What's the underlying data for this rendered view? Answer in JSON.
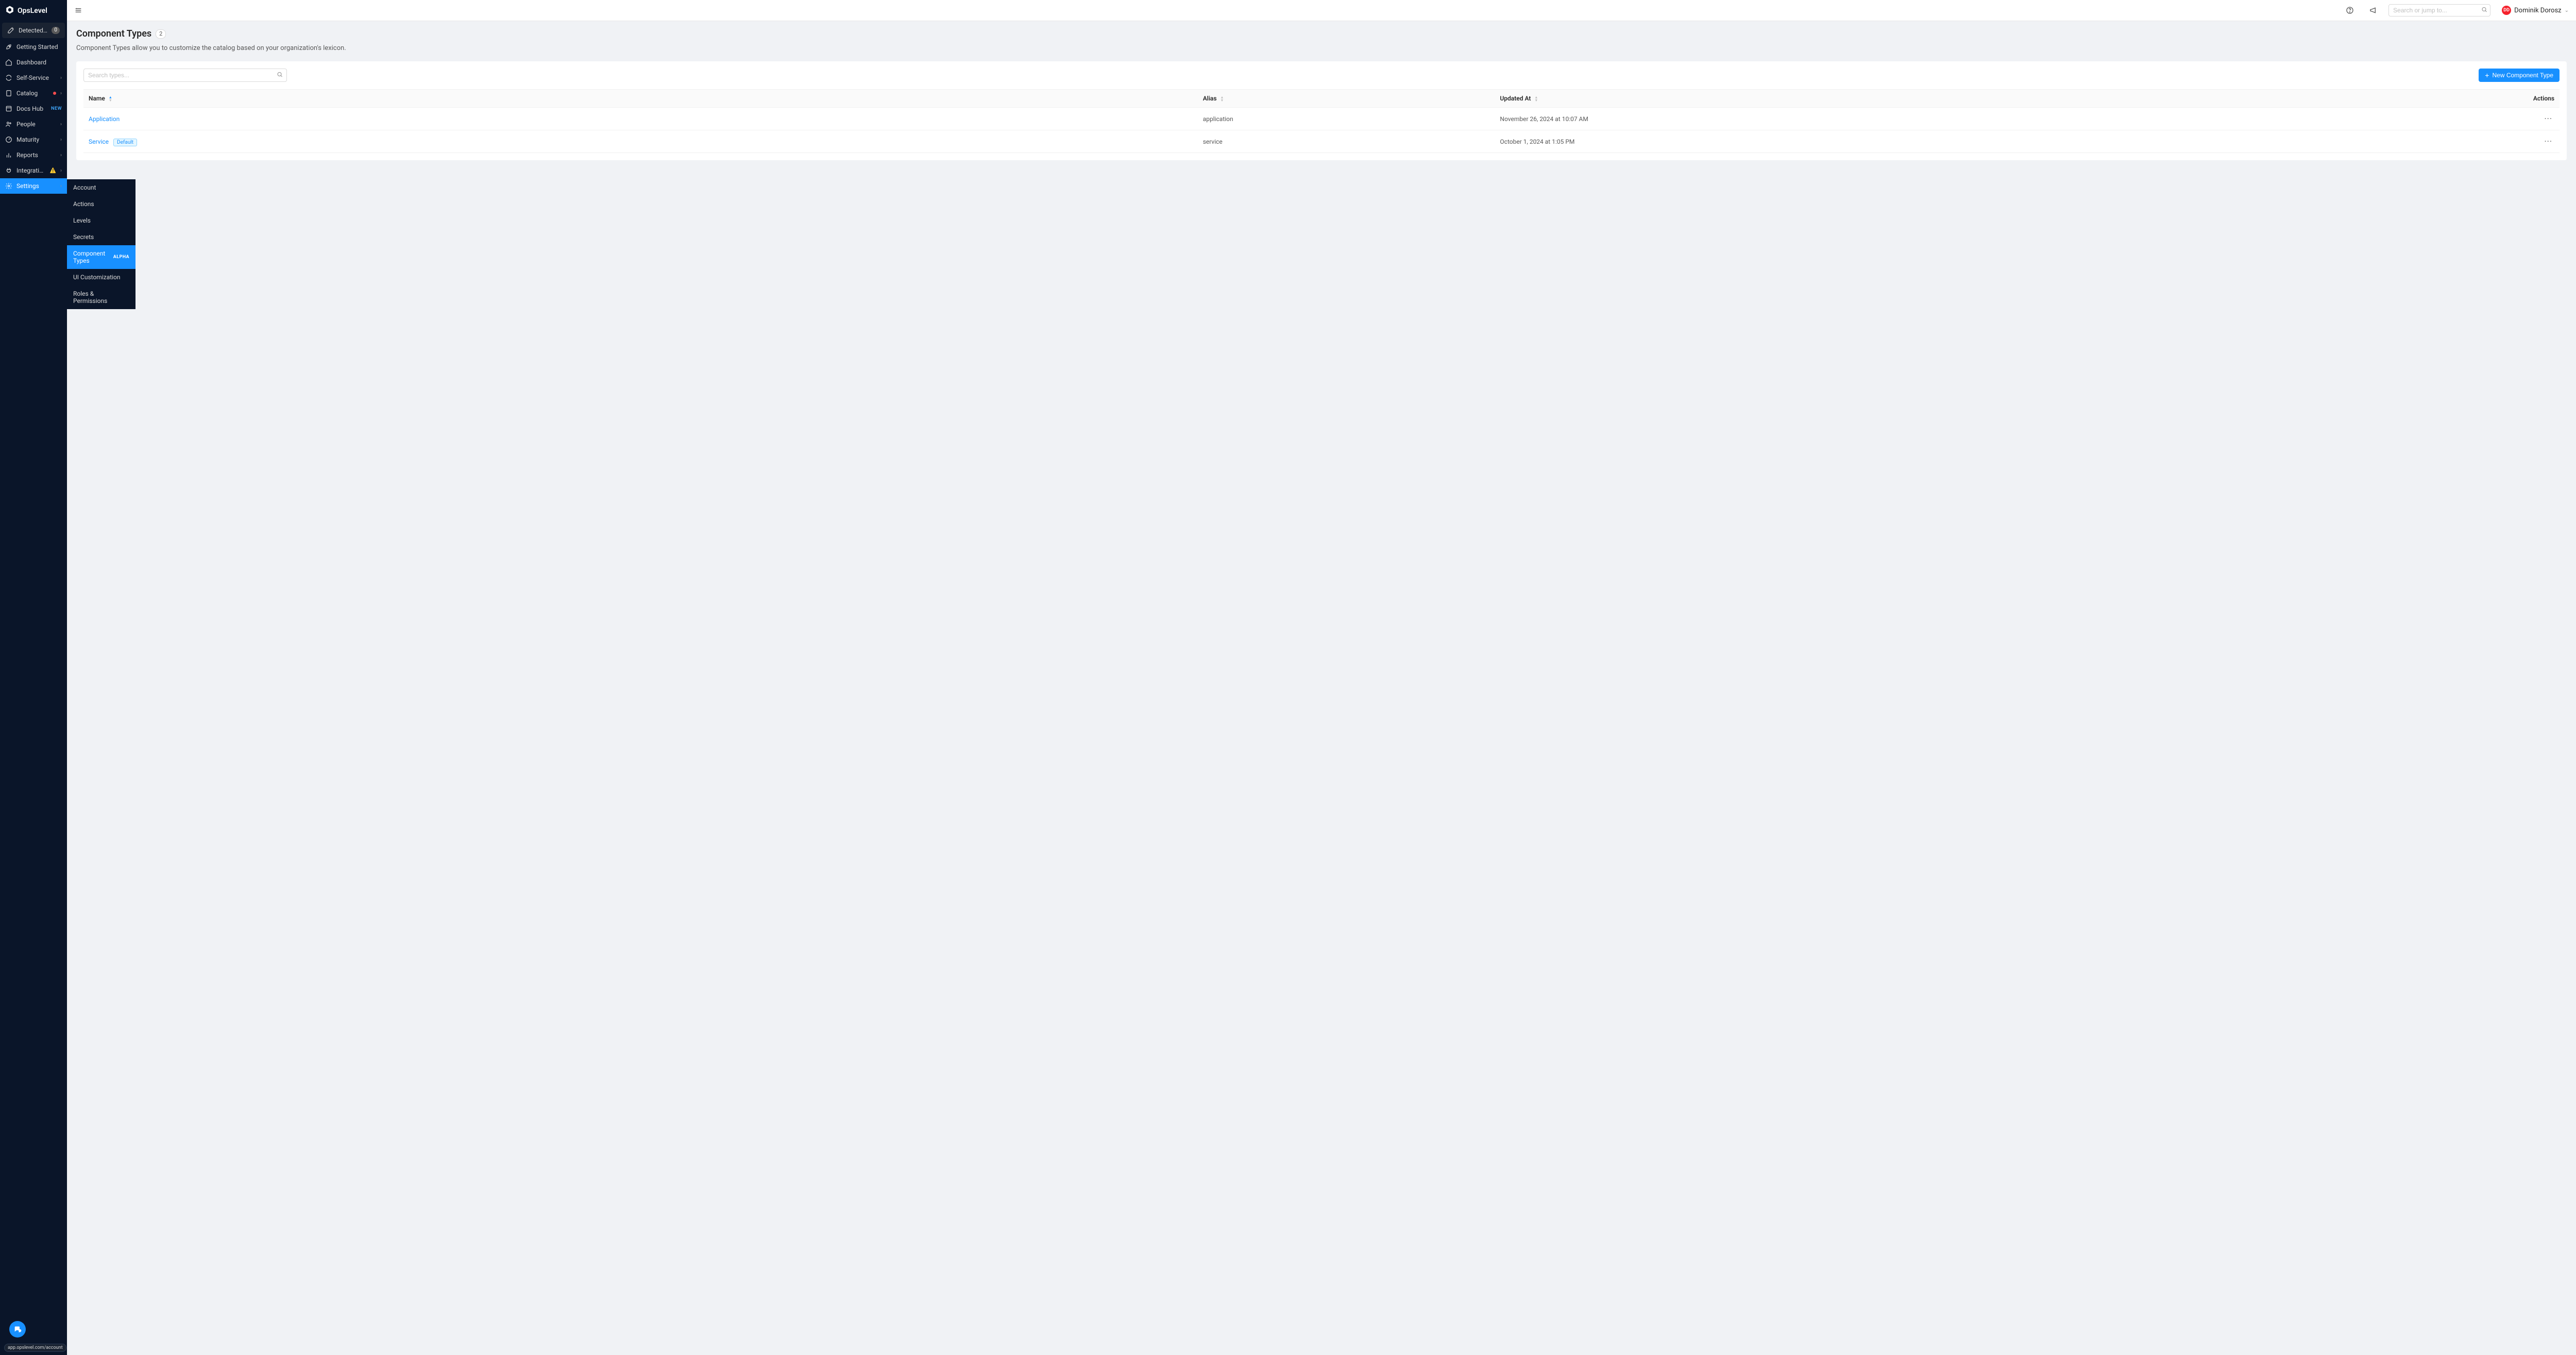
{
  "brand": {
    "name": "OpsLevel"
  },
  "sidebar": {
    "items": [
      {
        "label": "Detected Services",
        "icon": "wand",
        "count": "0",
        "kind": "dark"
      },
      {
        "label": "Getting Started",
        "icon": "rocket"
      },
      {
        "label": "Dashboard",
        "icon": "home"
      },
      {
        "label": "Self-Service",
        "icon": "refresh",
        "chevron": true
      },
      {
        "label": "Catalog",
        "icon": "file",
        "dot": true,
        "chevron": true
      },
      {
        "label": "Docs Hub",
        "icon": "book",
        "new_badge": "NEW"
      },
      {
        "label": "People",
        "icon": "users",
        "chevron": true
      },
      {
        "label": "Maturity",
        "icon": "gauge",
        "chevron": true
      },
      {
        "label": "Reports",
        "icon": "chart",
        "chevron": true
      },
      {
        "label": "Integrations",
        "icon": "plug",
        "warn": "⚠️",
        "chevron": true
      },
      {
        "label": "Settings",
        "icon": "gear",
        "chevron": true,
        "active": true
      }
    ]
  },
  "submenu": {
    "items": [
      {
        "label": "Account"
      },
      {
        "label": "Actions"
      },
      {
        "label": "Levels"
      },
      {
        "label": "Secrets"
      },
      {
        "label": "Component Types",
        "alpha": "ALPHA",
        "active": true
      },
      {
        "label": "UI Customization"
      },
      {
        "label": "Roles & Permissions"
      }
    ]
  },
  "url_hint": "app.opslevel.com/account",
  "topbar": {
    "search_placeholder": "Search or jump to...",
    "user_name": "Dominik Dorosz",
    "user_initials": "DD"
  },
  "page": {
    "title": "Component Types",
    "count": "2",
    "subtitle": "Component Types allow you to customize the catalog based on your organization's lexicon."
  },
  "card": {
    "search_placeholder": "Search types...",
    "new_button": "New Component Type"
  },
  "table": {
    "headers": {
      "name": "Name",
      "alias": "Alias",
      "updated": "Updated At",
      "actions": "Actions"
    },
    "rows": [
      {
        "name": "Application",
        "alias": "application",
        "updated": "November 26, 2024 at 10:07 AM",
        "default": false
      },
      {
        "name": "Service",
        "alias": "service",
        "updated": "October 1, 2024 at 1:05 PM",
        "default": true,
        "default_label": "Default"
      }
    ]
  },
  "colors": {
    "accent": "#1890ff",
    "sidebar_bg": "#0a1529"
  }
}
